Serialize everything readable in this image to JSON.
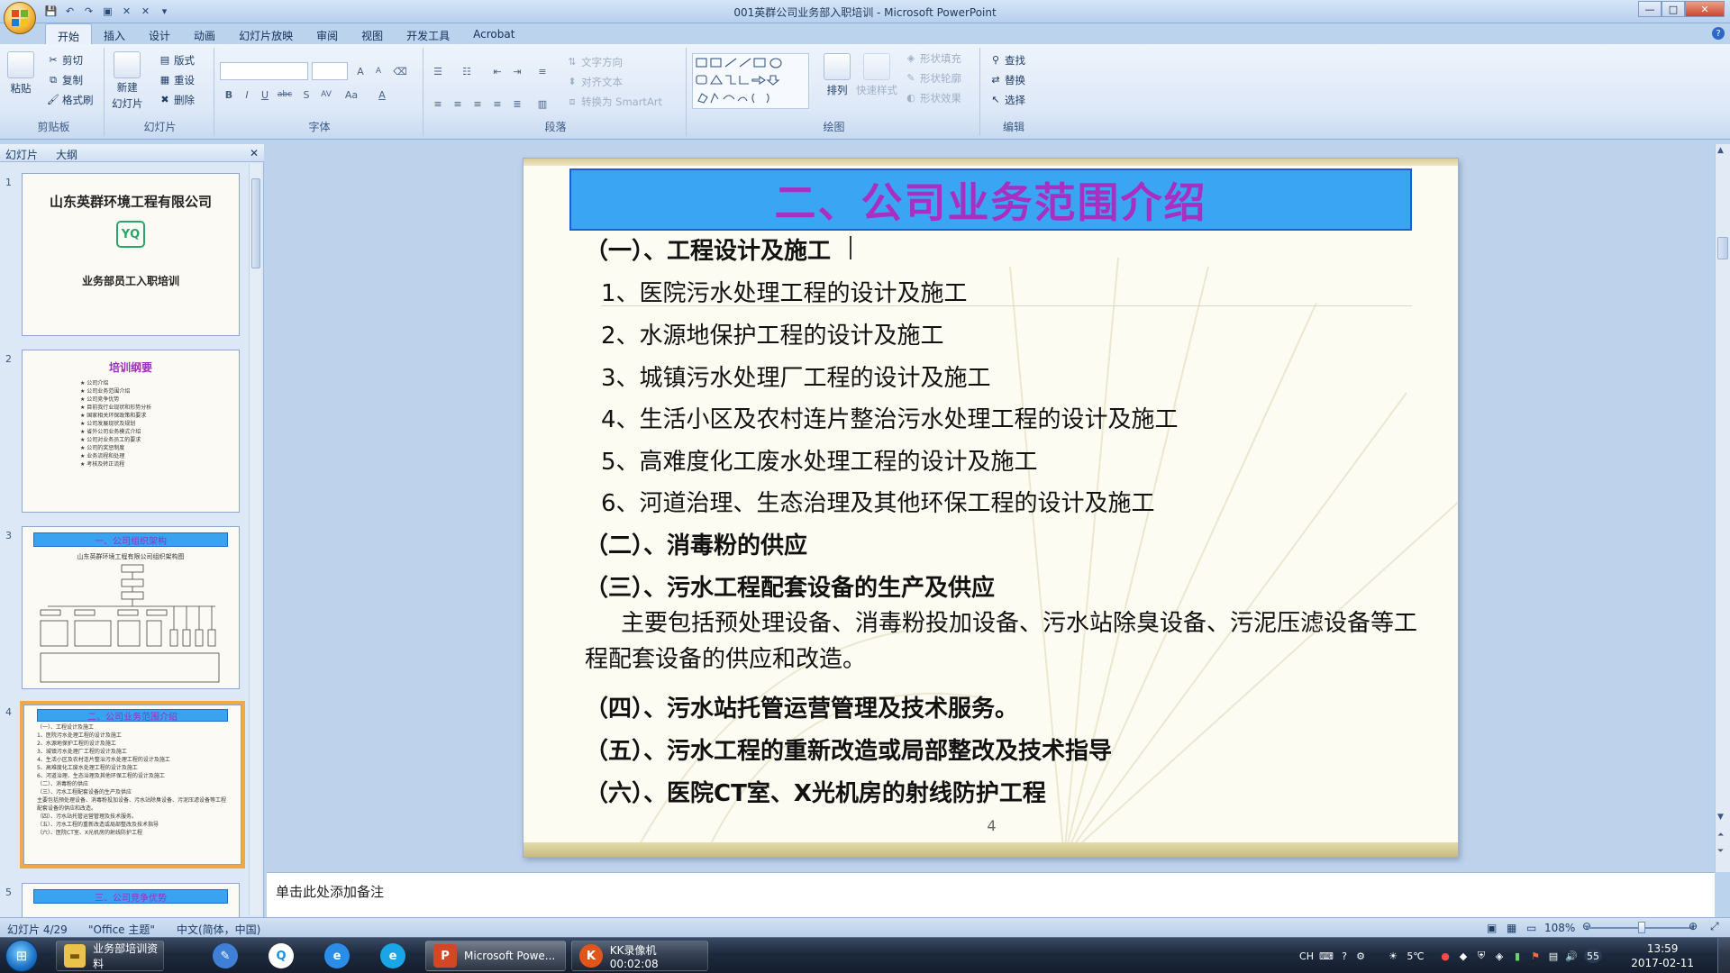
{
  "window": {
    "title": "001英群公司业务部入职培训 - Microsoft PowerPoint",
    "office_button": "",
    "controls": [
      "—",
      "□",
      "✕"
    ]
  },
  "qat": [
    "💾",
    "↶",
    "↷",
    "▣",
    "✕",
    "✕",
    "▾"
  ],
  "tabs": [
    "开始",
    "插入",
    "设计",
    "动画",
    "幻灯片放映",
    "审阅",
    "视图",
    "开发工具",
    "Acrobat"
  ],
  "ribbon": {
    "clipboard": {
      "label": "剪贴板",
      "paste": "粘贴",
      "cut": "剪切",
      "copy": "复制",
      "format_painter": "格式刷"
    },
    "slides": {
      "label": "幻灯片",
      "new_slide": "新建",
      "new_slide2": "幻灯片",
      "layout": "版式",
      "reset": "重设",
      "delete": "删除"
    },
    "font": {
      "label": "字体",
      "bold": "B",
      "italic": "I",
      "underline": "U",
      "strike": "abc",
      "shadow": "S",
      "spacing": "AV",
      "case": "Aa",
      "color": "A",
      "grow": "A",
      "shrink": "A"
    },
    "paragraph": {
      "label": "段落",
      "text_direction": "文字方向",
      "align_text": "对齐文本",
      "smartart": "转换为 SmartArt"
    },
    "drawing": {
      "label": "绘图",
      "arrange": "排列",
      "quick_styles": "快速样式",
      "shape_fill": "形状填充",
      "shape_outline": "形状轮廓",
      "shape_effects": "形状效果"
    },
    "editing": {
      "label": "编辑",
      "find": "查找",
      "replace": "替换",
      "select": "选择"
    }
  },
  "left_pane": {
    "tab_slides": "幻灯片",
    "tab_outline": "大纲",
    "thumbs": [
      {
        "num": "1",
        "company": "山东英群环境工程有限公司",
        "logo": "YQ",
        "subtitle": "业务部员工入职培训"
      },
      {
        "num": "2",
        "title": "培训纲要",
        "lines": [
          "★ 公司介绍",
          "★ 公司业务范围介绍",
          "★ 公司竞争优势",
          "★ 目前我行业现状和形势分析",
          "★ 国家相关环保政策和要求",
          "★ 公司发展现状及规划",
          "★ 省外公司业务模式介绍",
          "★ 公司对业务员工的要求",
          "★ 公司的奖惩制度",
          "★ 业务流程和处理",
          "★ 考核及转正流程"
        ]
      },
      {
        "num": "3",
        "title": "一、公司组织架构",
        "chart_title": "山东英群环境工程有限公司组织架构图"
      },
      {
        "num": "4",
        "title": "二、公司业务范围介绍",
        "lines": [
          "（一）、工程设计及施工",
          "1、医院污水处理工程的设计及施工",
          "2、水源地保护工程的设计及施工",
          "3、城镇污水处理厂工程的设计及施工",
          "4、生活小区及农村连片整治污水处理工程的设计及施工",
          "5、高难度化工废水处理工程的设计及施工",
          "6、河道治理、生态治理及其他环保工程的设计及施工",
          "（二）、消毒粉的供应",
          "（三）、污水工程配套设备的生产及供应",
          "主要包括预处理设备、消毒粉投加设备、污水站除臭设备、污泥压滤设备等工程配套设备的供应和改造。",
          "（四）、污水站托管运营管理及技术服务。",
          "（五）、污水工程的重新改造或局部整改及技术指导",
          "（六）、医院CT室、X光机房的射线防护工程"
        ]
      },
      {
        "num": "5",
        "title": "三、公司竞争优势"
      }
    ]
  },
  "slide": {
    "title": "二、公司业务范围介绍",
    "h1": "（一）、工程设计及施工",
    "items": [
      "1、医院污水处理工程的设计及施工",
      "2、水源地保护工程的设计及施工",
      "3、城镇污水处理厂工程的设计及施工",
      "4、生活小区及农村连片整治污水处理工程的设计及施工",
      "5、高难度化工废水处理工程的设计及施工",
      "6、河道治理、生态治理及其他环保工程的设计及施工"
    ],
    "h2": "（二）、消毒粉的供应",
    "h3": "（三）、污水工程配套设备的生产及供应",
    "para": "主要包括预处理设备、消毒粉投加设备、污水站除臭设备、污泥压滤设备等工程配套设备的供应和改造。",
    "h4": "（四）、污水站托管运营管理及技术服务。",
    "h5": "（五）、污水工程的重新改造或局部整改及技术指导",
    "h6": "（六）、医院CT室、X光机房的射线防护工程",
    "number": "4"
  },
  "notes": {
    "placeholder": "单击此处添加备注"
  },
  "status": {
    "slide_info": "幻灯片 4/29",
    "theme": "\"Office 主题\"",
    "language": "中文(简体，中国)",
    "zoom": "108%"
  },
  "taskbar": {
    "items": [
      {
        "label": "业务部培训资料",
        "icon": "folder-icon"
      },
      {
        "label": "Microsoft Powe...",
        "icon": "powerpoint-icon"
      },
      {
        "label": "KK录像机 00:02:08",
        "icon": "kk-recorder-icon"
      }
    ],
    "tray": {
      "lang": "CH",
      "temp": "5℃",
      "badge": "55",
      "time": "13:59",
      "date": "2017-02-11"
    }
  },
  "colors": {
    "title_bg": "#3aa6f3",
    "title_text": "#a82fc1",
    "accent_orange": "#f3a848",
    "ribbon_blue": "#dde8f7"
  }
}
